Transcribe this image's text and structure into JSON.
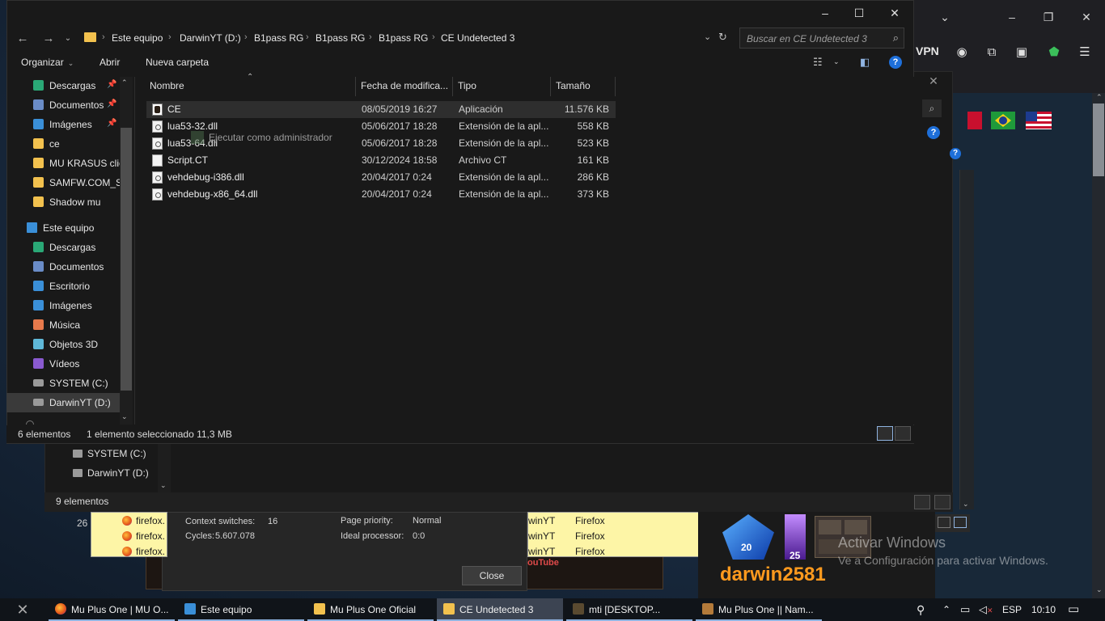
{
  "explorer": {
    "title_controls": {
      "minimize": "–",
      "maximize": "☐",
      "close": "✕"
    },
    "breadcrumb": [
      "Este equipo",
      "DarwinYT (D:)",
      "B1pass RG",
      "B1pass RG",
      "B1pass RG",
      "CE Undetected 3"
    ],
    "search_placeholder": "Buscar en CE Undetected 3",
    "toolbar": {
      "organize": "Organizar",
      "open": "Abrir",
      "new_folder": "Nueva carpeta"
    },
    "nav": {
      "quick": [
        {
          "label": "Descargas",
          "icon": "download-icon",
          "color": "#2aa876",
          "pinned": true
        },
        {
          "label": "Documentos",
          "icon": "documents-icon",
          "color": "#6a8cc7",
          "pinned": true
        },
        {
          "label": "Imágenes",
          "icon": "images-icon",
          "color": "#3a8fd8",
          "pinned": true
        },
        {
          "label": "ce",
          "icon": "folder-icon",
          "color": "#f2c14e",
          "pinned": false
        },
        {
          "label": "MU KRASUS clie",
          "icon": "folder-icon",
          "color": "#f2c14e",
          "pinned": false
        },
        {
          "label": "SAMFW.COM_SI",
          "icon": "folder-icon",
          "color": "#f2c14e",
          "pinned": false
        },
        {
          "label": "Shadow mu",
          "icon": "folder-icon",
          "color": "#f2c14e",
          "pinned": false
        }
      ],
      "this_pc": "Este equipo",
      "pc_items": [
        {
          "label": "Descargas",
          "icon": "download-icon",
          "color": "#2aa876"
        },
        {
          "label": "Documentos",
          "icon": "documents-icon",
          "color": "#6a8cc7"
        },
        {
          "label": "Escritorio",
          "icon": "desktop-icon",
          "color": "#3a8fd8"
        },
        {
          "label": "Imágenes",
          "icon": "images-icon",
          "color": "#3a8fd8"
        },
        {
          "label": "Música",
          "icon": "music-icon",
          "color": "#e87a4c"
        },
        {
          "label": "Objetos 3D",
          "icon": "objects3d-icon",
          "color": "#5fb8d8"
        },
        {
          "label": "Vídeos",
          "icon": "videos-icon",
          "color": "#8a5ad0"
        },
        {
          "label": "SYSTEM (C:)",
          "icon": "drive-icon",
          "color": "#9a9a9a"
        },
        {
          "label": "DarwinYT (D:)",
          "icon": "drive-icon",
          "color": "#9a9a9a"
        }
      ]
    },
    "columns": {
      "name": "Nombre",
      "date": "Fecha de modifica...",
      "type": "Tipo",
      "size": "Tamaño"
    },
    "files": [
      {
        "name": "CE",
        "date": "08/05/2019 16:27",
        "type": "Aplicación",
        "size": "11.576 KB",
        "icon": "app",
        "selected": true
      },
      {
        "name": "lua53-32.dll",
        "date": "05/06/2017 18:28",
        "type": "Extensión de la apl...",
        "size": "558 KB",
        "icon": "dll",
        "selected": false
      },
      {
        "name": "lua53-64.dll",
        "date": "05/06/2017 18:28",
        "type": "Extensión de la apl...",
        "size": "523 KB",
        "icon": "dll",
        "selected": false
      },
      {
        "name": "Script.CT",
        "date": "30/12/2024 18:58",
        "type": "Archivo CT",
        "size": "161 KB",
        "icon": "doc",
        "selected": false
      },
      {
        "name": "vehdebug-i386.dll",
        "date": "20/04/2017 0:24",
        "type": "Extensión de la apl...",
        "size": "286 KB",
        "icon": "dll",
        "selected": false
      },
      {
        "name": "vehdebug-x86_64.dll",
        "date": "20/04/2017 0:24",
        "type": "Extensión de la apl...",
        "size": "373 KB",
        "icon": "dll",
        "selected": false
      }
    ],
    "ghost_tooltip": "Ejecutar como administrador",
    "status": {
      "count": "6 elementos",
      "selection": "1 elemento seleccionado  11,3 MB"
    }
  },
  "bg_explorer": {
    "drives": [
      "SYSTEM (C:)",
      "DarwinYT (D:)"
    ],
    "status": "9 elementos",
    "partial_text": "26"
  },
  "process_monitor": {
    "left_rows": [
      "firefox.",
      "firefox.",
      "firefox."
    ],
    "right_rows": [
      "winYT",
      "winYT",
      "winYT"
    ],
    "right_rows_app": [
      "Firefox",
      "Firefox",
      "Firefox"
    ],
    "context_switches_label": "Context switches:",
    "context_switches_value": "16",
    "cycles_label": "Cycles:",
    "cycles_value": "5.607.078",
    "page_priority_label": "Page priority:",
    "page_priority_value": "Normal",
    "ideal_processor_label": "Ideal processor:",
    "ideal_processor_value": "0:0",
    "close_label": "Close",
    "youtube_text": "ouTube"
  },
  "browser": {
    "vpn_label": "VPN"
  },
  "game": {
    "gem_count": "20",
    "crystal_count": "25",
    "player_name": "darwin2581"
  },
  "watermark": {
    "line1": "Activar Windows",
    "line2": "Ve a Configuración para activar Windows."
  },
  "taskbar": {
    "items": [
      {
        "label": "Mu Plus One | MU O...",
        "icon": "firefox-icon"
      },
      {
        "label": "Este equipo",
        "icon": "computer-icon"
      },
      {
        "label": "Mu Plus One Oficial",
        "icon": "folder-icon"
      },
      {
        "label": "CE Undetected 3",
        "icon": "folder-icon"
      },
      {
        "label": "mti          [DESKTOP...",
        "icon": "cheat-engine-icon"
      },
      {
        "label": "Mu Plus One || Nam...",
        "icon": "game-icon"
      }
    ],
    "language": "ESP",
    "time": "10:10"
  }
}
